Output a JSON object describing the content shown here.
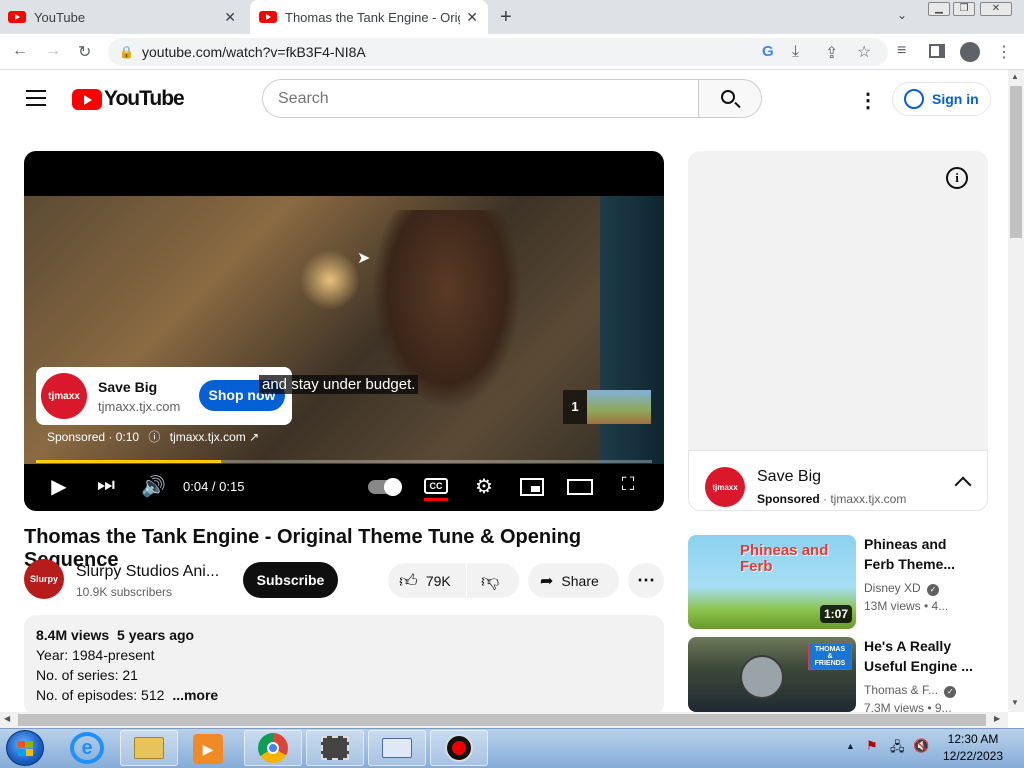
{
  "browser": {
    "tabs": [
      {
        "title": "YouTube"
      },
      {
        "title": "Thomas the Tank Engine - Origin"
      }
    ],
    "new_tab_symbol": "+",
    "url": "youtube.com/watch?v=fkB3F4-NI8A"
  },
  "youtube": {
    "logo_text": "YouTube",
    "search_placeholder": "Search",
    "signin_label": "Sign in"
  },
  "player": {
    "ad": {
      "name": "Save Big",
      "domain": "tjmaxx.tjx.com",
      "logo_text": "tjmaxx",
      "cta": "Shop now",
      "sponsored_line": "Sponsored · 0:10",
      "sponsored_link": "tjmaxx.tjx.com",
      "ad_count": "1"
    },
    "caption": "and stay under budget.",
    "time": "0:04 / 0:15",
    "progress_fraction": 0.27,
    "cc_label": "CC"
  },
  "side_ad": {
    "title": "Save Big",
    "sponsored": "Sponsored",
    "domain": "· tjmaxx.tjx.com",
    "logo_text": "tjmaxx"
  },
  "video": {
    "title": "Thomas the Tank Engine - Original Theme Tune & Opening Sequence",
    "channel": "Slurpy Studios Ani...",
    "subscribers": "10.9K subscribers",
    "channel_avatar_text": "Slurpy",
    "subscribe_label": "Subscribe",
    "likes": "79K",
    "share_label": "Share"
  },
  "description": {
    "views": "8.4M views",
    "age": "5 years ago",
    "lines": [
      "Year: 1984-present",
      "No. of series: 21",
      "No. of episodes: 512"
    ],
    "more": "...more"
  },
  "related": [
    {
      "title": "Phineas and Ferb Theme...",
      "channel": "Disney XD",
      "meta": "13M views  • 4...",
      "duration": "1:07",
      "thumb_text": "Phineas and Ferb"
    },
    {
      "title": "He's A Really Useful Engine ...",
      "channel": "Thomas & F...",
      "meta": "7.3M views  • 9...",
      "thumb_text": "THOMAS & FRIENDS"
    }
  ],
  "taskbar": {
    "time": "12:30 AM",
    "date": "12/22/2023"
  },
  "colors": {
    "youtube_red": "#ff0000",
    "accent_blue": "#065fd4",
    "progress": "#ffcc00",
    "tjmaxx_red": "#d9192b"
  }
}
